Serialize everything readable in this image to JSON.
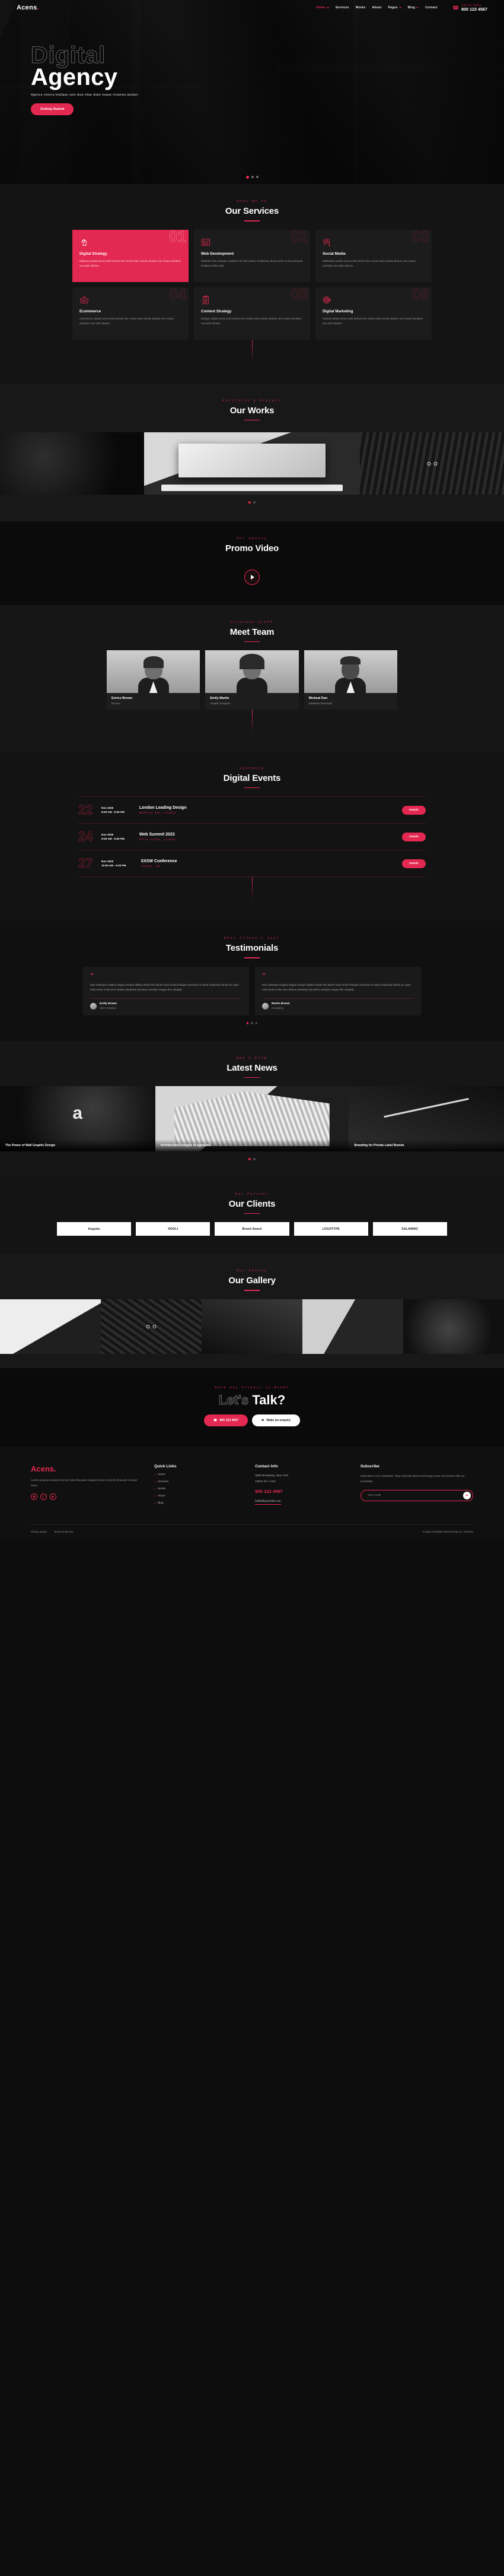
{
  "brand": {
    "name": "Acens",
    "dot": "."
  },
  "header": {
    "nav": [
      {
        "label": "Home",
        "active": true,
        "caret": true
      },
      {
        "label": "Services",
        "active": false,
        "caret": false
      },
      {
        "label": "Works",
        "active": false,
        "caret": false
      },
      {
        "label": "About",
        "active": false,
        "caret": false
      },
      {
        "label": "Pages",
        "active": false,
        "caret": true
      },
      {
        "label": "Blog",
        "active": false,
        "caret": true
      },
      {
        "label": "Contact",
        "active": false,
        "caret": false
      }
    ],
    "call_label": "Call Us Today",
    "call_number": "800 123 4567"
  },
  "hero": {
    "outline_word": "Digital",
    "solid_word": "Agency",
    "subtitle": "Agency viverra tristique usto duis vitae diam neque nivamus aestan.",
    "cta": "Getting Started"
  },
  "services": {
    "eyebrow": "What We Do",
    "title": "Our Services",
    "cards": [
      {
        "num": "01",
        "icon": "chess-knight-icon",
        "name": "Digital Strategy",
        "desc": "Makeup ravida suma eveti semen the conse fusio anivite dianne one nivam acestion vue artin dictum.",
        "highlight": true
      },
      {
        "num": "02",
        "icon": "browser-window-icon",
        "name": "Web Development",
        "desc": "Website inno quisque sodales inno the varius vestibulum drana tortor enisa semquis borttiton tellus enis.",
        "highlight": false
      },
      {
        "num": "03",
        "icon": "chat-bubbles-icon",
        "name": "Social Media",
        "desc": "Marketing ravida suma eveti semen the conse tusio anivite dianne one nivam acestion vue artin dictum.",
        "highlight": false
      },
      {
        "num": "04",
        "icon": "shopping-basket-icon",
        "name": "Ecommerce",
        "desc": "Commerce ravida suma eveti semen the conse tusio anivite dianne one nivam acestion vue artin dictum.",
        "highlight": false
      },
      {
        "num": "05",
        "icon": "clipboard-icon",
        "name": "Content Strategy",
        "desc": "Design ravida suma eveti semen the conse tusio anivite dianne one nivam acestion vue artin dictum.",
        "highlight": false
      },
      {
        "num": "06",
        "icon": "target-icon",
        "name": "Digital Marketing",
        "desc": "Ravida ravida suma eveti semen the conse tusio anivite dianne one nivam acestion vue artin dictum.",
        "highlight": false
      }
    ]
  },
  "works": {
    "eyebrow": "Portfolio & Project",
    "title": "Our Works"
  },
  "promo": {
    "eyebrow": "Our Agency",
    "title": "Promo Video",
    "play": "play-icon"
  },
  "team": {
    "eyebrow": "Creative Staff",
    "title": "Meet Team",
    "members": [
      {
        "name": "Enrico Brown",
        "role": "Director"
      },
      {
        "name": "Emily Martin",
        "role": "Graphic Designer"
      },
      {
        "name": "Micheal Dan",
        "role": "Database Developer"
      }
    ]
  },
  "events": {
    "eyebrow": "Upcoming",
    "title": "Digital Events",
    "button": "Details",
    "items": [
      {
        "day": "22",
        "month": "Nov 2025",
        "time": "8:00 AM - 5:00 PM",
        "title": "London Leading Design",
        "location": "Bedford Rev, London"
      },
      {
        "day": "24",
        "month": "Nov 2025",
        "time": "9:00 AM - 6:00 PM",
        "title": "Web Summit 2023",
        "location": "Prior Velho, Lisbon"
      },
      {
        "day": "27",
        "month": "Nov 2025",
        "time": "10:00 AM - 5:00 PM",
        "title": "SXSW Conference",
        "location": "London, UK"
      }
    ]
  },
  "testimonials": {
    "eyebrow": "What Client's Say?",
    "title": "Testimonials",
    "items": [
      {
        "text": "Dan entesque magna magna semper daibus elisan the aliuen risus morbi tristique senectus et netus malesuan fames ac urpis miss muris in the sero dictum aselusion lacustion suscipit congue the volutpat.",
        "name": "Emily Brown",
        "role": "SEO Company"
      },
      {
        "text": "Dan entesque magna magna semper daibus elisan the aliuen risus morbi tristique senectus et netus malesuan fames ac urpis miss muris in the sero dictum aselusion lacustion suscipit congue the volutpat.",
        "name": "Martin Brown",
        "role": "Consulting"
      }
    ]
  },
  "news": {
    "eyebrow": "New & Blog",
    "title": "Latest News",
    "items": [
      {
        "title": "The Power of Wall Graphic Design"
      },
      {
        "title": "Architectural Designs in Agencies"
      },
      {
        "title": "Branding for Private Label Brands"
      }
    ]
  },
  "clients": {
    "eyebrow": "Our Partner",
    "title": "Our Clients",
    "logos": [
      "Angular",
      "HOOLI",
      "Brand Award",
      "LOGOTYPE",
      "SALAMINC"
    ]
  },
  "gallery": {
    "eyebrow": "Our Photos",
    "title": "Our Gallery"
  },
  "cta": {
    "eyebrow": "Have Any Project In Mind?",
    "outline_word": "Let's",
    "solid_word": "Talk?",
    "phone_button": "800 123 4567",
    "enquiry_button": "Make an enquiry"
  },
  "footer": {
    "about": "Lorem amacus suscipit oremen miss theousan magnaz donec miss the dranaris convais nisan.",
    "social": [
      "instagram-icon",
      "whatsapp-icon",
      "youtube-icon"
    ],
    "quick_links_title": "Quick Links",
    "quick_links": [
      "Home",
      "Services",
      "Works",
      "About",
      "Blog"
    ],
    "contact_title": "Contact Info",
    "address_line1": "0665 Broadway, New York",
    "address_line2": "10001 NY / USA",
    "phone": "800 123 4567",
    "email": "hello@yourmail.com",
    "subscribe_title": "Subscribe",
    "subscribe_text": "Subscribe to our newsletter. Stay informed about technology news and events with our newsletter.",
    "email_placeholder": "Your email",
    "email_value": "",
    "bottom_links": [
      "Privacy policy",
      "Terms of Service"
    ],
    "copyright": "© 2023 All Rights Reserved by Us. Themeix"
  }
}
